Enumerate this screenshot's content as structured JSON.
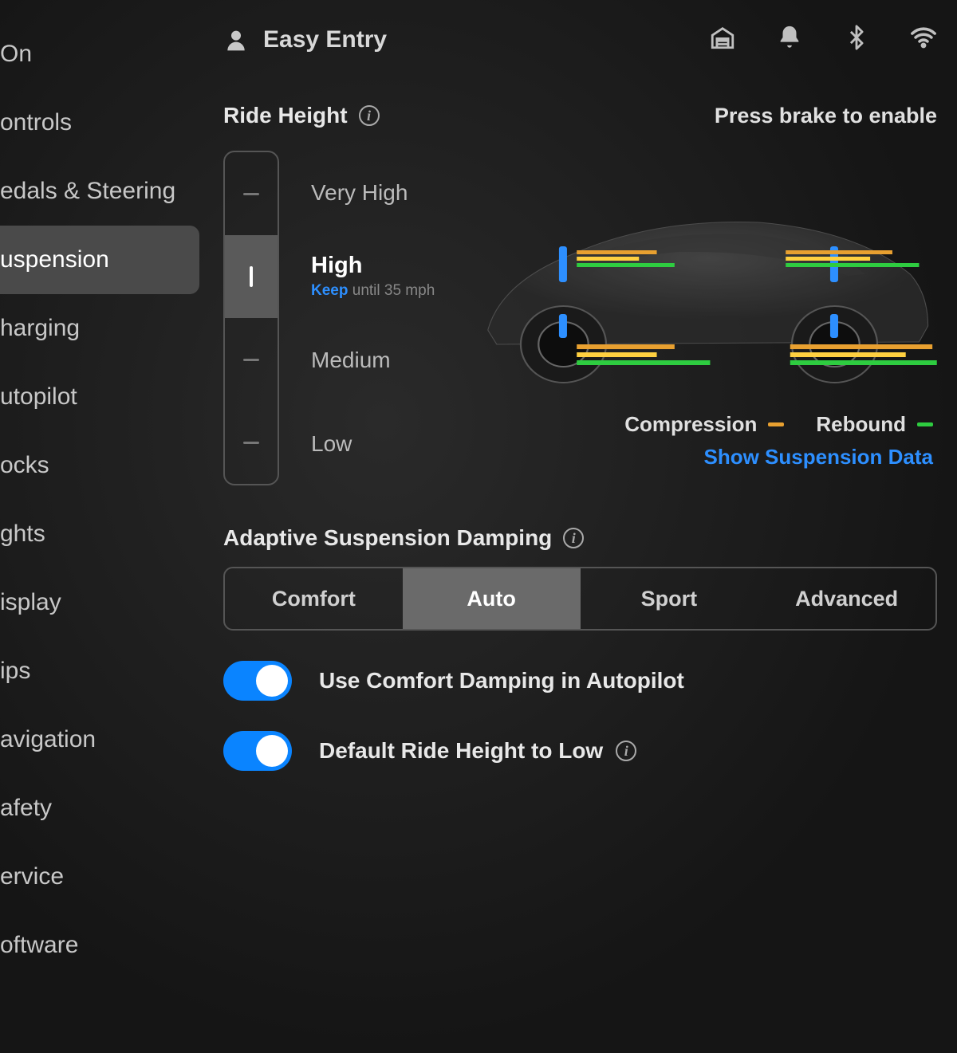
{
  "header": {
    "profile_label": "Easy Entry"
  },
  "sidebar": {
    "items": [
      {
        "label": "On",
        "selected": false
      },
      {
        "label": "ontrols",
        "selected": false
      },
      {
        "label": "edals & Steering",
        "selected": false
      },
      {
        "label": "uspension",
        "selected": true
      },
      {
        "label": "harging",
        "selected": false
      },
      {
        "label": "utopilot",
        "selected": false
      },
      {
        "label": "ocks",
        "selected": false
      },
      {
        "label": "ghts",
        "selected": false
      },
      {
        "label": "isplay",
        "selected": false
      },
      {
        "label": "ips",
        "selected": false
      },
      {
        "label": "avigation",
        "selected": false
      },
      {
        "label": "afety",
        "selected": false
      },
      {
        "label": "ervice",
        "selected": false
      },
      {
        "label": "oftware",
        "selected": false
      }
    ]
  },
  "ride_height": {
    "title": "Ride Height",
    "note": "Press brake to enable",
    "levels": [
      {
        "label": "Very High",
        "active": false
      },
      {
        "label": "High",
        "active": true,
        "sub_keep": "Keep",
        "sub_rest": " until 35 mph"
      },
      {
        "label": "Medium",
        "active": false
      },
      {
        "label": "Low",
        "active": false
      }
    ]
  },
  "viz": {
    "compression_label": "Compression",
    "rebound_label": "Rebound",
    "link_label": "Show Suspension Data",
    "colors": {
      "compression": "#e8a030",
      "rebound": "#2ecc40"
    }
  },
  "damping": {
    "title": "Adaptive Suspension Damping",
    "options": [
      {
        "label": "Comfort",
        "active": false
      },
      {
        "label": "Auto",
        "active": true
      },
      {
        "label": "Sport",
        "active": false
      },
      {
        "label": "Advanced",
        "active": false
      }
    ]
  },
  "toggles": {
    "comfort_autopilot": {
      "label": "Use Comfort Damping in Autopilot",
      "on": true
    },
    "default_low": {
      "label": "Default Ride Height to Low",
      "on": true
    }
  }
}
